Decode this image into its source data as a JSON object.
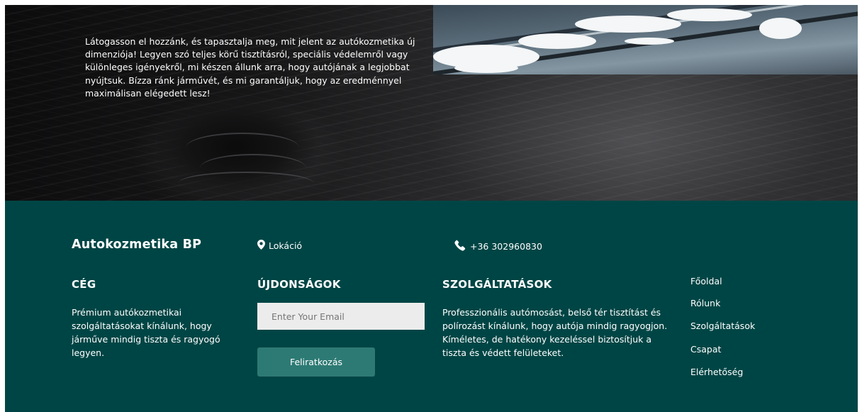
{
  "hero": {
    "paragraph": "Látogasson el hozzánk, és tapasztalja meg, mit jelent az autókozmetika új dimenziója! Legyen szó teljes körű tisztításról, speciális védelemről vagy különleges igényekről, mi készen állunk arra, hogy autójának a legjobbat nyújtsuk. Bízza ránk járművét, és mi garantáljuk, hogy az eredménnyel maximálisan elégedett lesz!"
  },
  "footer": {
    "brand": "Autokozmetika BP",
    "location_label": "Lokáció",
    "location_icon": "map-pin-icon",
    "phone": "+36 302960830",
    "phone_icon": "phone-icon",
    "company": {
      "title": "CÉG",
      "text": "Prémium autókozmetikai szolgáltatásokat kínálunk, hogy járműve mindig tiszta és ragyogó legyen."
    },
    "news": {
      "title": "ÚJDONSÁGOK",
      "email_placeholder": "Enter Your Email",
      "subscribe_label": "Feliratkozás"
    },
    "services": {
      "title": "SZOLGÁLTATÁSOK",
      "text": "Professzionális autómosást, belső tér tisztítást és polírozást kínálunk, hogy autója mindig ragyogjon. Kíméletes, de hatékony kezeléssel biztosítjuk a tiszta és védett felületeket."
    },
    "links": [
      "Főoldal",
      "Rólunk",
      "Szolgáltatások",
      "Csapat",
      "Elérhetőség"
    ]
  },
  "colors": {
    "footer_bg": "#004545",
    "button_bg": "#2d7a74",
    "input_bg": "#ececec"
  }
}
